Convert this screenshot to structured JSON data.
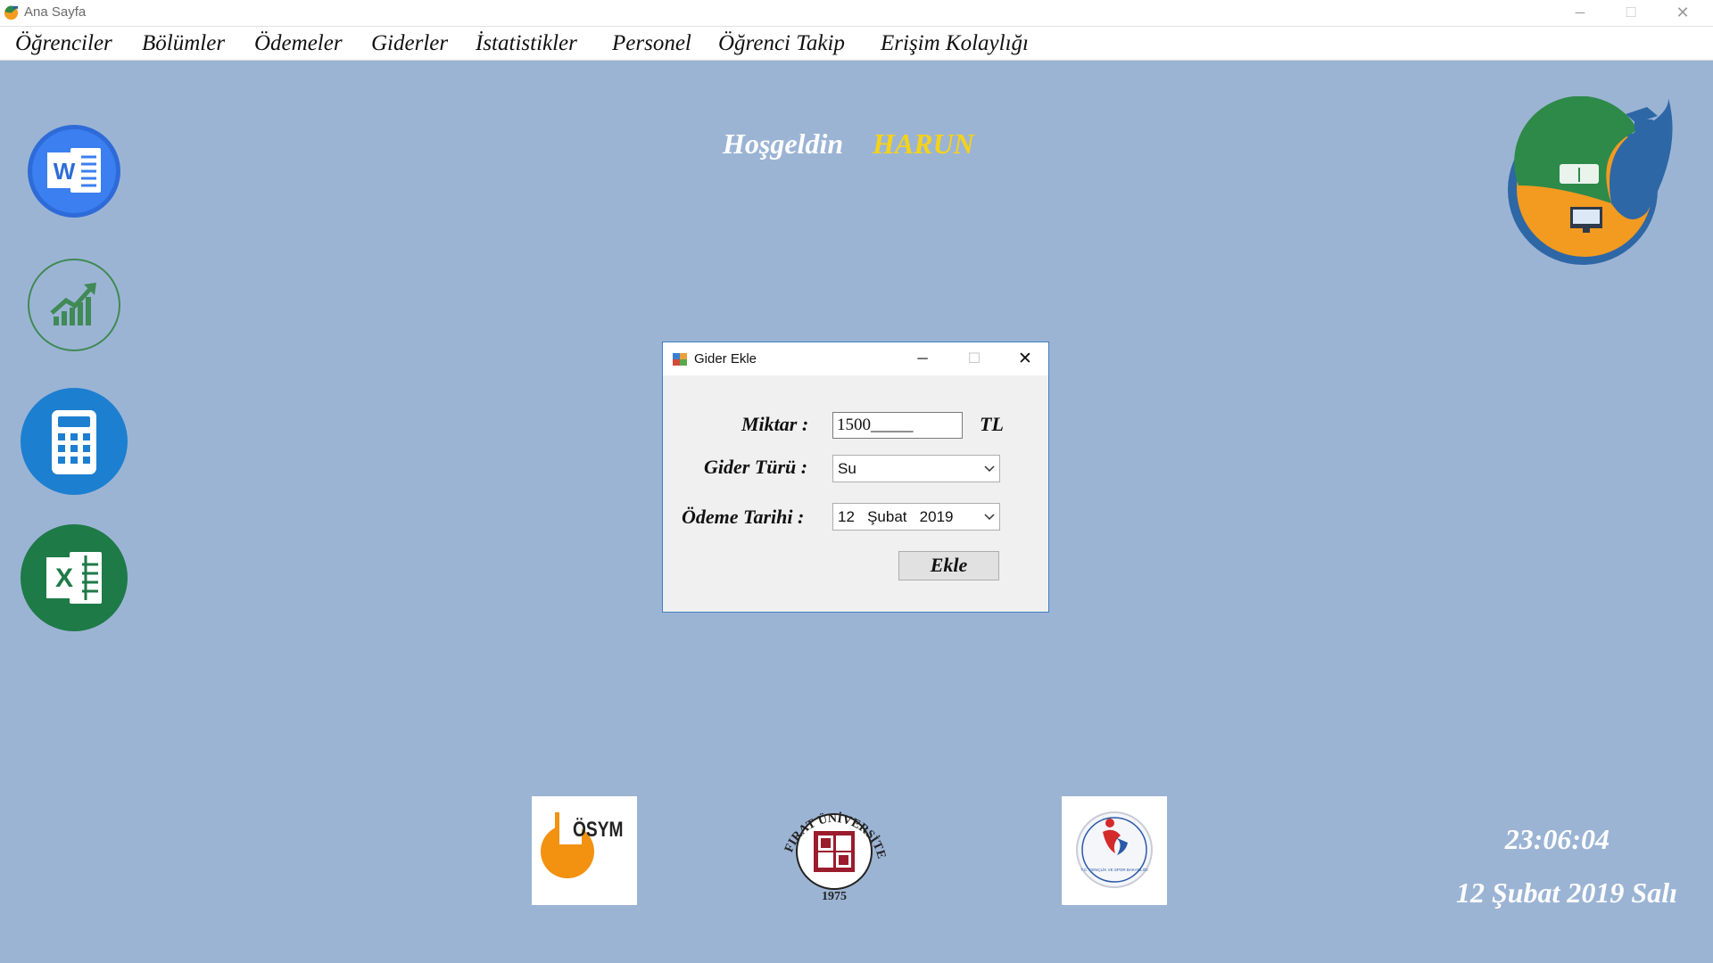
{
  "window": {
    "title": "Ana Sayfa"
  },
  "menu": [
    {
      "label": "Öğrenciler"
    },
    {
      "label": "Bölümler"
    },
    {
      "label": "Ödemeler"
    },
    {
      "label": "Giderler"
    },
    {
      "label": "İstatistikler"
    },
    {
      "label": "Personel"
    },
    {
      "label": "Öğrenci Takip"
    },
    {
      "label": "Erişim Kolaylığı"
    }
  ],
  "side_icons": [
    "word-icon",
    "chart-growth-icon",
    "calculator-icon",
    "excel-icon"
  ],
  "welcome": {
    "greeting": "Hoşgeldin",
    "name": "HARUN",
    "name_color": "#f5d21a"
  },
  "dialog": {
    "title": "Gider Ekle",
    "amount_label": "Miktar :",
    "amount_value": "1500_____",
    "currency": "TL",
    "type_label": "Gider Türü :",
    "type_value": "Su",
    "date_label": "Ödeme Tarihi :",
    "date_value": "12   Şubat   2019",
    "submit_label": "Ekle"
  },
  "logos": {
    "osym": "ÖSYM",
    "firat_top": "FIRAT ÜNİVERSİTESİ",
    "firat_year": "1975",
    "ministry": "T.C. GENÇLİK VE SPOR BAKANLIĞI"
  },
  "clock": {
    "time": "23:06:04",
    "date": "12 Şubat 2019 Salı"
  },
  "colors": {
    "background": "#9cb4d4",
    "dialog_border": "#3f7fc1"
  }
}
